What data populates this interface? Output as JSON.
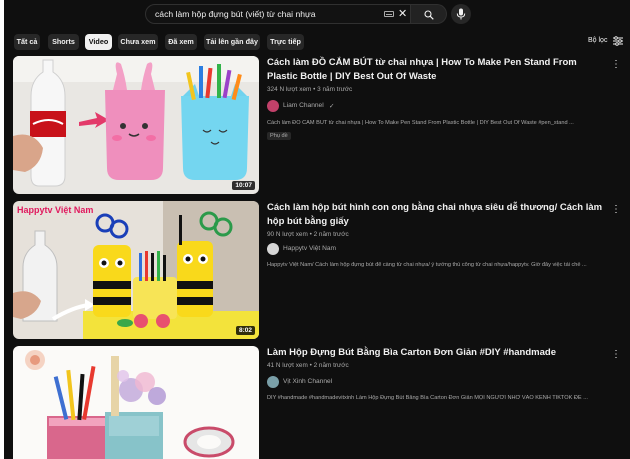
{
  "search": {
    "query": "cách làm hộp đựng bút (viết) từ chai nhựa",
    "clear_icon": "close-icon",
    "keyboard_icon": "keyboard-icon",
    "search_icon": "search-icon",
    "mic_icon": "microphone-icon"
  },
  "chips": [
    "Tất cả",
    "Shorts",
    "Video",
    "Chưa xem",
    "Đã xem",
    "Tải lên gần đây",
    "Trực tiếp"
  ],
  "active_chip": "Video",
  "filter": {
    "label": "Bộ lọc",
    "icon": "filter-sliders-icon"
  },
  "results": [
    {
      "title": "Cách làm ĐỒ CẮM BÚT từ chai nhựa | How To Make Pen Stand From Plastic Bottle | DIY Best Out Of Waste",
      "meta": "324 N lượt xem • 3 năm trước",
      "channel": "Liam Channel",
      "verified": "✓",
      "description": "Cách làm ĐỒ CẮM BÚT từ chai nhựa | How To Make Pen Stand From Plastic Bottle | DIY Best Out Of Waste #pen_stand ...",
      "badge": "Phụ đề",
      "duration": "10:07"
    },
    {
      "title": "Cách làm hộp bút hình con ong bằng chai nhựa siêu dễ thương/ Cách làm hộp bút bằng giấy",
      "meta": "90 N lượt xem • 2 năm trước",
      "channel": "Happytv Việt Nam",
      "description": "Happytv Việt Nam/ Cách làm hộp đựng bút để càng từ chai nhựa/ ý tưởng thủ công từ chai nhựa/happytv. Giờ đây việc tái chế ...",
      "thumb_text": "Happytv Việt Nam",
      "duration": "8:02"
    },
    {
      "title": "Làm Hộp Đựng Bút Bằng Bìa Carton Đơn Giản #DIY #handmade",
      "meta": "41 N lượt xem • 2 năm trước",
      "channel": "Vịt Xinh Channel",
      "description": "DIY #handmade #handmadevitxinh Làm Hộp Đựng Bút Bằng Bìa Carton Đơn Giản MỌI NGƯỜI NHỚ VÀO KÊNH TIKTOK ĐỂ ..."
    }
  ],
  "more_icon": "more-vert-icon"
}
